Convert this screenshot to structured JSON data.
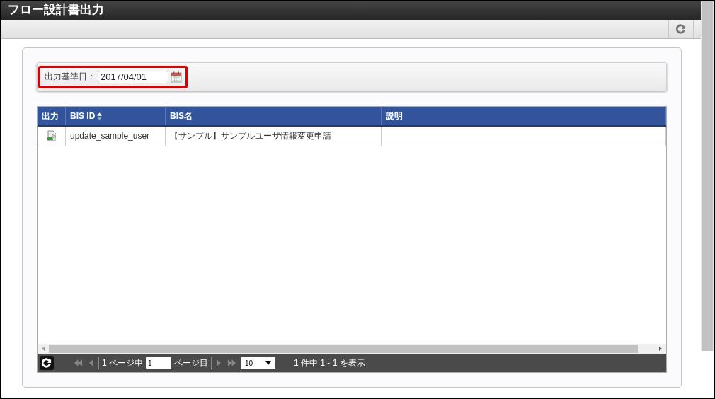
{
  "window": {
    "title": "フロー設計書出力"
  },
  "filter": {
    "label": "出力基準日：",
    "value": "2017/04/01",
    "highlighted": true
  },
  "table": {
    "columns": [
      {
        "label": "出力",
        "sortable": false
      },
      {
        "label": "BIS ID",
        "sortable": true
      },
      {
        "label": "BIS名",
        "sortable": false
      },
      {
        "label": "説明",
        "sortable": false
      }
    ],
    "rows": [
      {
        "bis_id": "update_sample_user",
        "bis_name": "【サンプル】サンプルユーザ情報変更申請"
      }
    ]
  },
  "pager": {
    "page_of": "1 ページ中",
    "page": "1",
    "page_suffix": "ページ目",
    "per_page": "10",
    "summary": "1 件中 1 - 1 を表示"
  }
}
